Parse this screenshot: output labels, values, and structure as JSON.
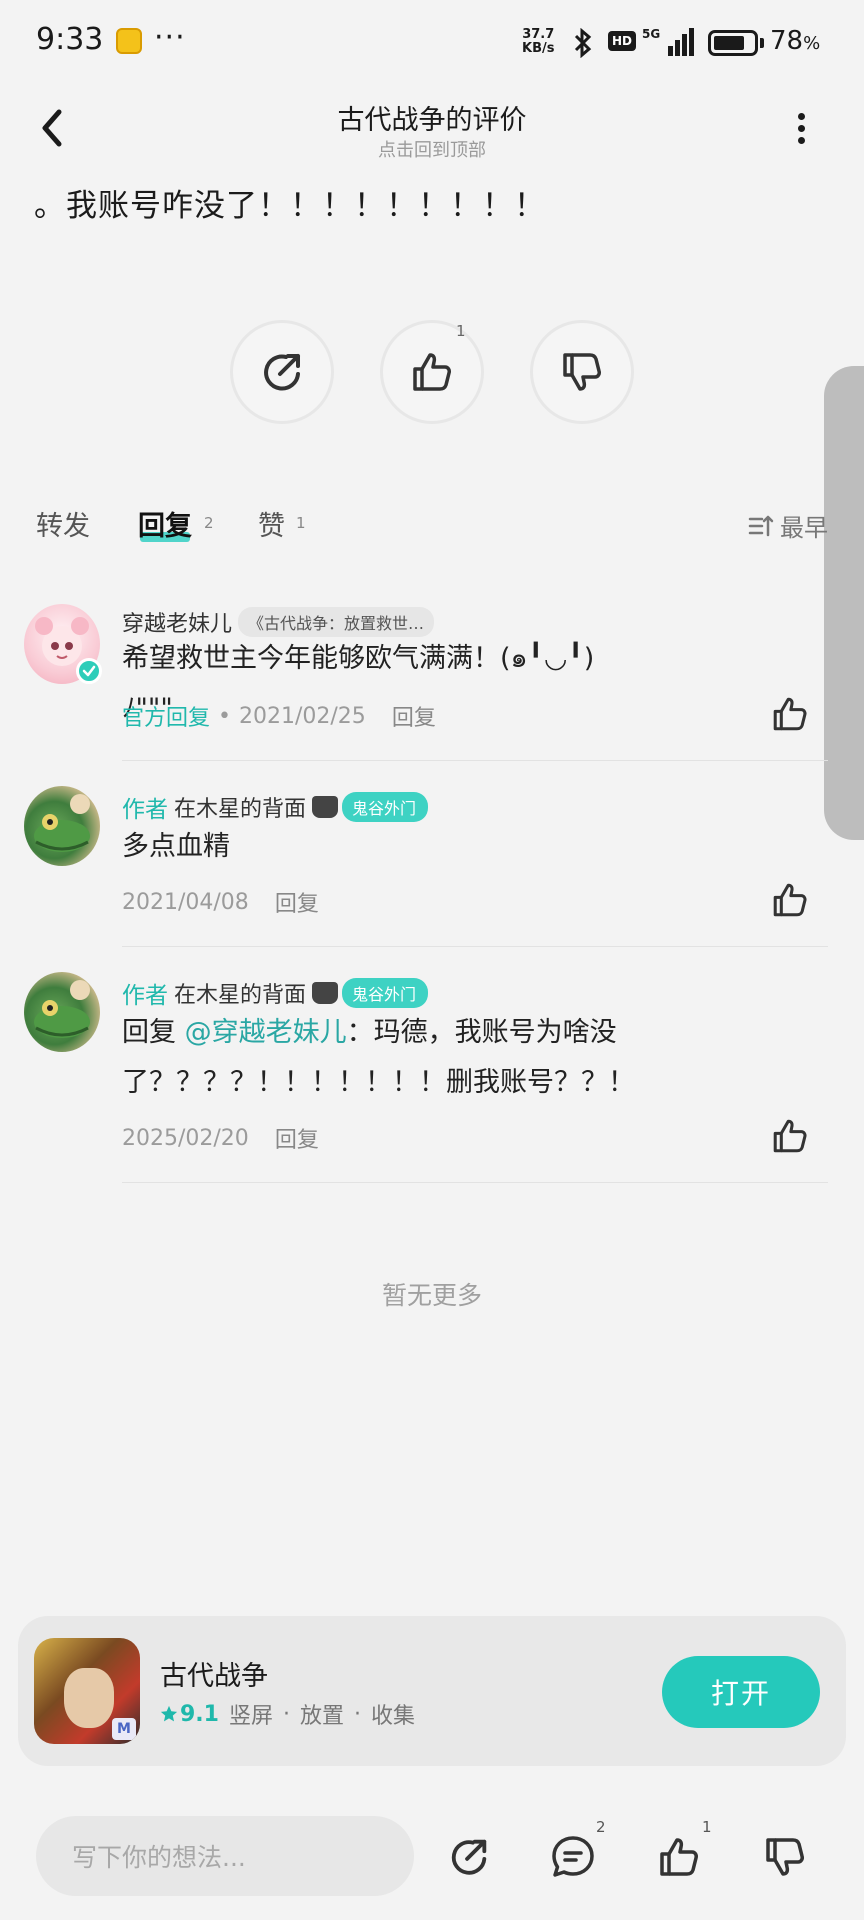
{
  "status_bar": {
    "time": "9:33",
    "more": "···",
    "speed_top": "37.7",
    "speed_bottom": "KB/s",
    "hd": "HD",
    "network": "5G",
    "battery_percent": 78,
    "battery_text": "78",
    "battery_unit": "%"
  },
  "header": {
    "title": "古代战争的评价",
    "subtitle": "点击回到顶部"
  },
  "post": {
    "text": "。我账号咋没了！！！！！！！！！",
    "like_count": "1"
  },
  "tabs": [
    {
      "label": "转发",
      "count": ""
    },
    {
      "label": "回复",
      "count": "2"
    },
    {
      "label": "赞",
      "count": "1"
    }
  ],
  "sort_label": "最早",
  "comments": [
    {
      "name": "穿越老妹儿",
      "game_pill": "《古代战争：放置救世…",
      "text": "希望救世主今年能够欧气满满！(๑╹◡╹)ﾉ\"\"\"",
      "official": "官方回复",
      "date": "2021/02/25",
      "reply": "回复"
    },
    {
      "author_tag": "作者",
      "name": "在木星的背面",
      "rank": "鬼谷外门",
      "text": "多点血精",
      "date": "2021/04/08",
      "reply": "回复"
    },
    {
      "author_tag": "作者",
      "name": "在木星的背面",
      "rank": "鬼谷外门",
      "reply_prefix": "回复 ",
      "mention": "@穿越老妹儿",
      "text_line1": "：玛德，我账号为啥没",
      "text_line2": "了？？？？！！！！！！！删我账号？？！",
      "date": "2025/02/20",
      "reply": "回复"
    }
  ],
  "no_more": "暂无更多",
  "game_card": {
    "name": "古代战争",
    "rating": "9.1",
    "tags": [
      "竖屏",
      "放置",
      "收集"
    ],
    "separator": "·",
    "open_label": "打开",
    "icon_mark": "M"
  },
  "bottom_bar": {
    "placeholder": "写下你的想法...",
    "comment_count": "2",
    "like_count": "1"
  },
  "colors": {
    "accent": "#25c9bb",
    "background": "#f3f3f3"
  }
}
